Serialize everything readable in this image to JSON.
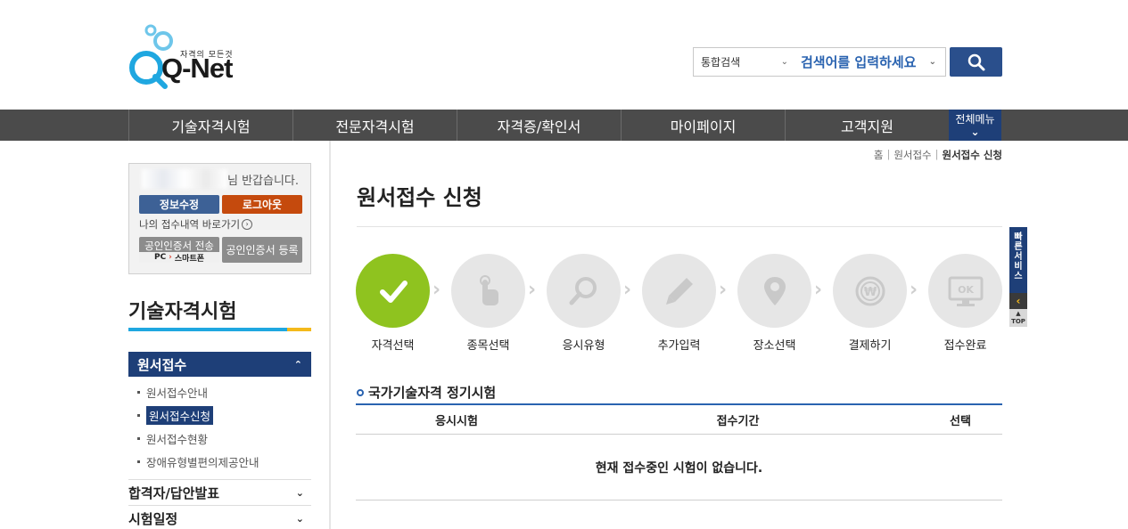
{
  "header": {
    "logo": {
      "sub": "자격의 모든것",
      "brand": "Q-Net"
    },
    "search": {
      "category": "통합검색",
      "keyword": "검색어를 입력하세요"
    }
  },
  "nav": {
    "items": [
      "기술자격시험",
      "전문자격시험",
      "자격증/확인서",
      "마이페이지",
      "고객지원"
    ],
    "all_menu": "전체메뉴"
  },
  "login": {
    "greeting": "님 반갑습니다.",
    "info_button": "정보수정",
    "logout_button": "로그아웃",
    "my_history": "나의 접수내역 바로가기",
    "cert_send": "공인인증서 전송",
    "cert_send_pc": "PC",
    "cert_send_phone": "스마트폰",
    "cert_register": "공인인증서 등록"
  },
  "sidebar": {
    "section_title": "기술자격시험",
    "active_menu": "원서접수",
    "sub_items": [
      "원서접수안내",
      "원서접수신청",
      "원서접수현황",
      "장애유형별편의제공안내"
    ],
    "groups": [
      "합격자/답안발표",
      "시험일정"
    ]
  },
  "breadcrumb": [
    "홈",
    "원서접수",
    "원서접수 신청"
  ],
  "page_title": "원서접수 신청",
  "steps": [
    {
      "label": "자격선택",
      "icon": "check-icon",
      "done": true
    },
    {
      "label": "종목선택",
      "icon": "hand-pointer-icon",
      "done": false
    },
    {
      "label": "응시유형",
      "icon": "magnifier-icon",
      "done": false
    },
    {
      "label": "추가입력",
      "icon": "pencil-icon",
      "done": false
    },
    {
      "label": "장소선택",
      "icon": "location-pin-icon",
      "done": false
    },
    {
      "label": "결제하기",
      "icon": "won-coin-icon",
      "done": false
    },
    {
      "label": "접수완료",
      "icon": "monitor-ok-icon",
      "done": false
    }
  ],
  "quick": {
    "service": "빠른서비스",
    "top": "TOP"
  },
  "table": {
    "title": "국가기술자격 정기시험",
    "headers": [
      "응시시험",
      "접수기간",
      "선택"
    ],
    "empty": "현재 접수중인 시험이 없습니다."
  },
  "colors": {
    "navy": "#1e3f78",
    "accent_blue": "#1fa7e0",
    "done_green": "#8fc31f",
    "logout_orange": "#c54a0d"
  }
}
